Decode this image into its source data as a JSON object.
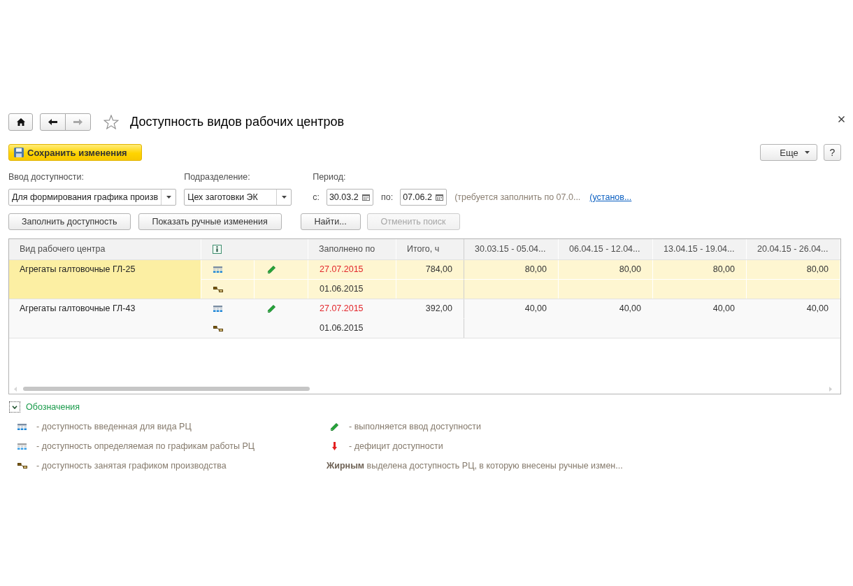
{
  "window": {
    "title": "Доступность видов рабочих центров",
    "favorite": false
  },
  "history": [
    {
      "kind": "back",
      "disabled": false
    },
    {
      "kind": "forward",
      "disabled": true
    }
  ],
  "toolbar": {
    "save_button": "Сохранить изменения",
    "more_button": "Еще",
    "help_button": "?"
  },
  "filters": [
    {
      "label": "Ввод доступности:",
      "value": "Для формирования графика произв"
    },
    {
      "label": "Подразделение:",
      "value": "Цех заготовки ЭК"
    }
  ],
  "period": {
    "label": "Период:",
    "from_label": "с:",
    "from": "30.03.2",
    "to_label": "по:",
    "to": "07.06.2",
    "hint": "(требуется заполнить по 07.0...",
    "link": "(установ..."
  },
  "actions": [
    {
      "label": "Заполнить доступность",
      "disabled": false
    },
    {
      "label": "Показать ручные изменения",
      "disabled": false
    },
    {
      "label": "Найти...",
      "disabled": false
    },
    {
      "label": "Отменить поиск",
      "disabled": true
    }
  ],
  "table": {
    "columns": [
      {
        "kind": "text",
        "label": "Вид рабочего центра"
      },
      {
        "kind": "info"
      },
      {
        "kind": "text",
        "label": "Заполнено по"
      },
      {
        "kind": "text",
        "label": "Итого, ч"
      },
      {
        "kind": "text",
        "label": "30.03.15 - 05.04..."
      },
      {
        "kind": "text",
        "label": "06.04.15 - 12.04..."
      },
      {
        "kind": "text",
        "label": "13.04.15 - 19.04..."
      },
      {
        "kind": "text",
        "label": "20.04.15 - 26.04..."
      }
    ],
    "rows": [
      {
        "name": "Агрегаты галтовочные ГЛ-25",
        "selected": true,
        "by_schedule": false,
        "editing": true,
        "filled_until": "27.07.2015",
        "overdue": true,
        "occupied_until": "01.06.2015",
        "total": "784,00",
        "periods": [
          "80,00",
          "80,00",
          "80,00",
          "80,00"
        ]
      },
      {
        "name": "Агрегаты галтовочные ГЛ-43",
        "selected": false,
        "by_schedule": false,
        "editing": true,
        "filled_until": "27.07.2015",
        "overdue": true,
        "occupied_until": "01.06.2015",
        "total": "392,00",
        "periods": [
          "40,00",
          "40,00",
          "40,00",
          "40,00"
        ]
      }
    ]
  },
  "legend": {
    "title": "Обозначения",
    "expanded": true,
    "items": [
      {
        "kind": "entered",
        "text": "- доступность введенная для вида РЦ"
      },
      {
        "kind": "by_schedule",
        "text": "- доступность определяемая по графикам работы РЦ"
      },
      {
        "kind": "occupied",
        "text": "- доступность занятая графиком производства"
      },
      {
        "kind": "editing",
        "text": "- выполняется ввод доступности"
      },
      {
        "kind": "deficit",
        "text": "- дефицит доступности"
      },
      {
        "kind": "note",
        "text": "**Жирным** выделена доступность РЦ, в которую внесены ручные измен..."
      }
    ]
  }
}
